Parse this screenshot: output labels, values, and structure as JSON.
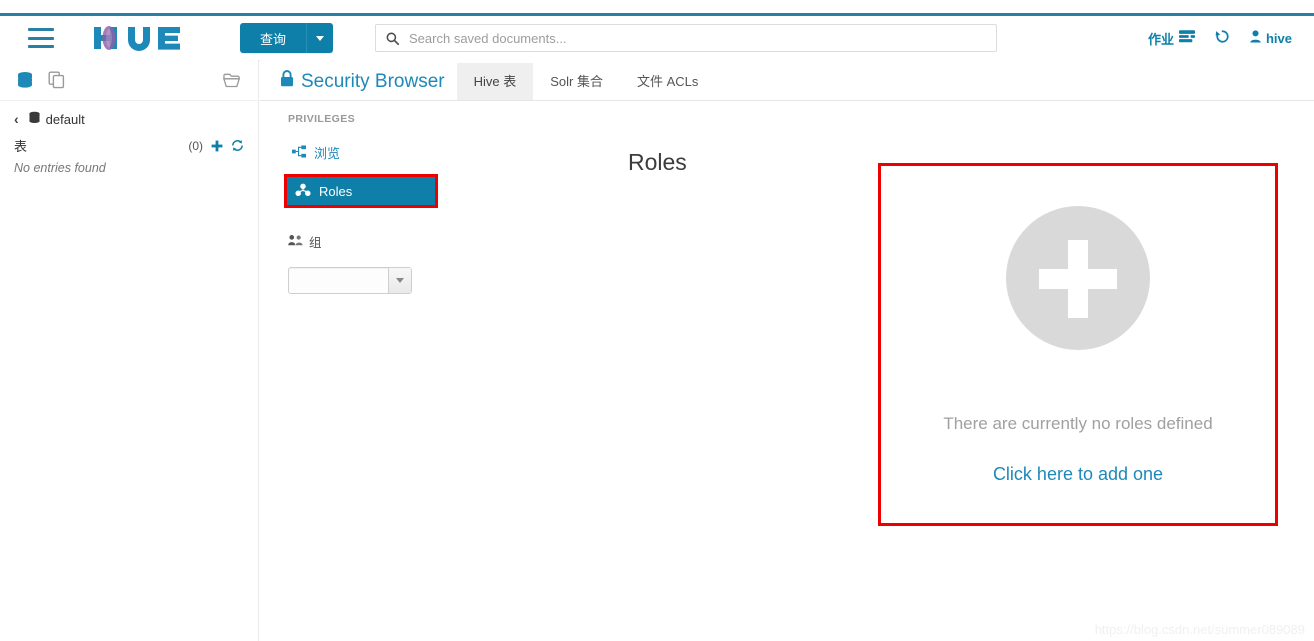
{
  "app": {
    "logo_text": "HUE"
  },
  "header": {
    "menu_icon": "hamburger-icon",
    "query_button": "查询",
    "search": {
      "placeholder": "Search saved documents...",
      "value": "",
      "icon": "search-icon"
    },
    "right_items": [
      {
        "label": "作业",
        "icon": "jobs-icon"
      },
      {
        "label": "",
        "icon": "history-icon"
      },
      {
        "label": "hive",
        "icon": "user-icon"
      }
    ]
  },
  "sidebar": {
    "toolbar_icons": [
      {
        "name": "database-icon",
        "state": "active"
      },
      {
        "name": "documents-icon",
        "state": "inactive"
      },
      {
        "name": "folder-open-icon",
        "state": "inactive"
      }
    ],
    "database": {
      "back": "‹",
      "name": "default",
      "icon": "database-icon"
    },
    "tables": {
      "label": "表",
      "count": "(0)",
      "add_icon": "plus-icon",
      "refresh_icon": "refresh-icon"
    },
    "empty_message": "No entries found"
  },
  "content": {
    "app_title": "Security Browser",
    "app_title_icon": "lock-icon",
    "tabs": [
      {
        "label": "Hive 表",
        "active": true
      },
      {
        "label": "Solr 集合",
        "active": false
      },
      {
        "label": "文件 ACLs",
        "active": false
      }
    ],
    "privileges": {
      "heading": "PRIVILEGES",
      "browse": {
        "label": "浏览",
        "icon": "sitemap-icon"
      },
      "roles": {
        "label": "Roles",
        "icon": "roles-icon",
        "active": true
      },
      "group": {
        "label": "组",
        "icon": "group-icon",
        "selected": "",
        "options": []
      }
    },
    "main": {
      "title": "Roles",
      "empty_icon": "plus-circle-icon",
      "empty_message": "There are currently no roles defined",
      "empty_action": "Click here to add one"
    }
  },
  "watermark": "https://blog.csdn.net/summer089089",
  "colors": {
    "brand_blue": "#0d7fa8",
    "link_blue": "#1d89b8",
    "highlight_red": "#ee0000",
    "empty_gray": "#d9d9d9"
  }
}
